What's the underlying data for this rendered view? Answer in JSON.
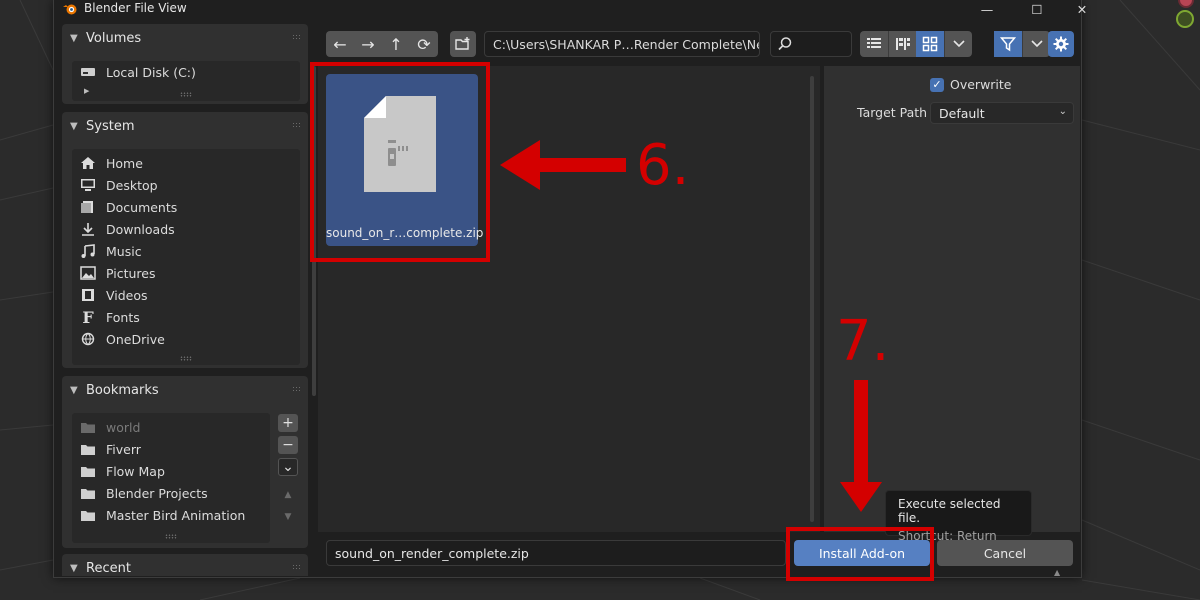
{
  "window": {
    "title": "Blender File View",
    "controls": {
      "minimize": "—",
      "maximize": "☐",
      "close": "✕"
    }
  },
  "sidebar": {
    "volumes": {
      "header": "Volumes",
      "items": [
        {
          "label": "Local Disk (C:)",
          "icon": "drive-icon"
        }
      ]
    },
    "system": {
      "header": "System",
      "items": [
        {
          "label": "Home",
          "icon": "home-icon"
        },
        {
          "label": "Desktop",
          "icon": "desktop-icon"
        },
        {
          "label": "Documents",
          "icon": "documents-icon"
        },
        {
          "label": "Downloads",
          "icon": "downloads-icon"
        },
        {
          "label": "Music",
          "icon": "music-icon"
        },
        {
          "label": "Pictures",
          "icon": "pictures-icon"
        },
        {
          "label": "Videos",
          "icon": "videos-icon"
        },
        {
          "label": "Fonts",
          "icon": "fonts-icon"
        },
        {
          "label": "OneDrive",
          "icon": "onedrive-icon"
        }
      ]
    },
    "bookmarks": {
      "header": "Bookmarks",
      "items": [
        {
          "label": "world",
          "icon": "folder-icon",
          "dimmed": true
        },
        {
          "label": "Fiverr",
          "icon": "folder-icon"
        },
        {
          "label": "Flow Map",
          "icon": "folder-icon"
        },
        {
          "label": "Blender Projects",
          "icon": "folder-icon"
        },
        {
          "label": "Master Bird Animation",
          "icon": "folder-icon"
        }
      ],
      "buttons": {
        "add": "+",
        "remove": "−",
        "menu": "⌄",
        "up": "▲",
        "down": "▼"
      }
    },
    "recent": {
      "header": "Recent"
    }
  },
  "toolbar": {
    "back": "←",
    "forward": "→",
    "parent": "↑",
    "refresh": "⟳",
    "path": "C:\\Users\\SHANKAR P…Render Complete\\New\\",
    "search_placeholder": ""
  },
  "browser": {
    "files": [
      {
        "name": "sound_on_r…complete.zip",
        "type": "zip",
        "selected": true
      }
    ]
  },
  "options": {
    "overwrite_label": "Overwrite",
    "overwrite_checked": true,
    "target_path_label": "Target Path",
    "target_path_value": "Default"
  },
  "footer": {
    "filename": "sound_on_render_complete.zip",
    "install_label": "Install Add-on",
    "cancel_label": "Cancel"
  },
  "tooltip": {
    "line1": "Execute selected file.",
    "line2": "Shortcut: Return"
  },
  "annotations": {
    "step6": "6.",
    "step7": "7.",
    "color": "#d40000"
  },
  "colors": {
    "accent": "#4772b3",
    "install_button": "#5680c2",
    "selected_thumb": "#3a5386"
  }
}
